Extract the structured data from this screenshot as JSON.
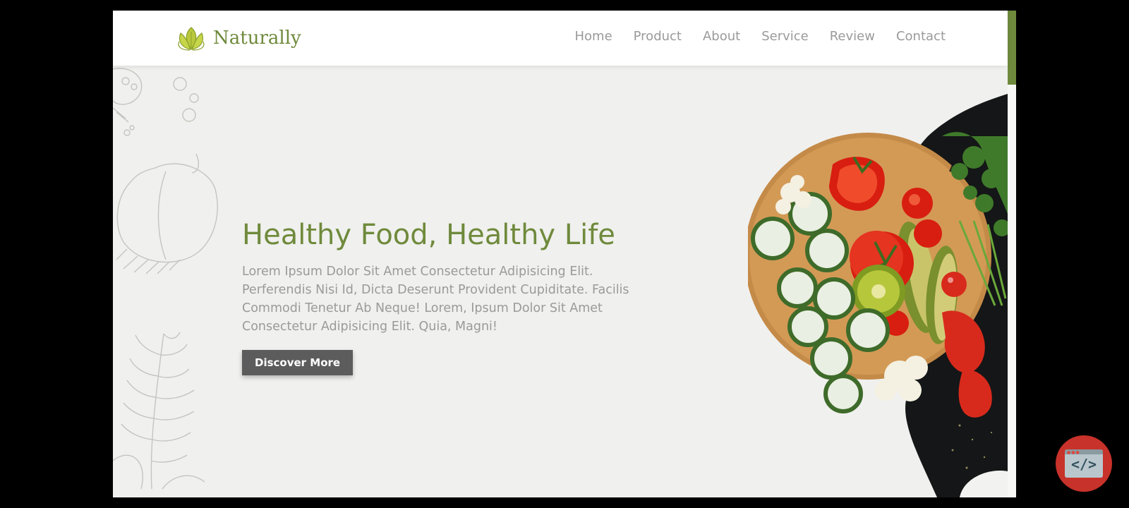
{
  "brand": {
    "name": "Naturally",
    "icon": "leaf-logo-icon",
    "color": "#6f8a3c"
  },
  "nav": {
    "items": [
      {
        "label": "Home"
      },
      {
        "label": "Product"
      },
      {
        "label": "About"
      },
      {
        "label": "Service"
      },
      {
        "label": "Review"
      },
      {
        "label": "Contact"
      }
    ]
  },
  "hero": {
    "title": "Healthy Food, Healthy Life",
    "description": "Lorem Ipsum Dolor Sit Amet Consectetur Adipisicing Elit. Perferendis Nisi Id, Dicta Deserunt Provident Cupiditate. Facilis Commodi Tenetur Ab Neque! Lorem, Ipsum Dolor Sit Amet Consectetur Adipisicing Elit. Quia, Magni!",
    "cta_label": "Discover More"
  },
  "widget": {
    "icon": "code-window-icon",
    "code_glyph": "</>"
  },
  "colors": {
    "accent": "#6f8a3c",
    "button": "#5c5c5c",
    "background": "#f0f0ee",
    "fab": "#c7322a"
  }
}
